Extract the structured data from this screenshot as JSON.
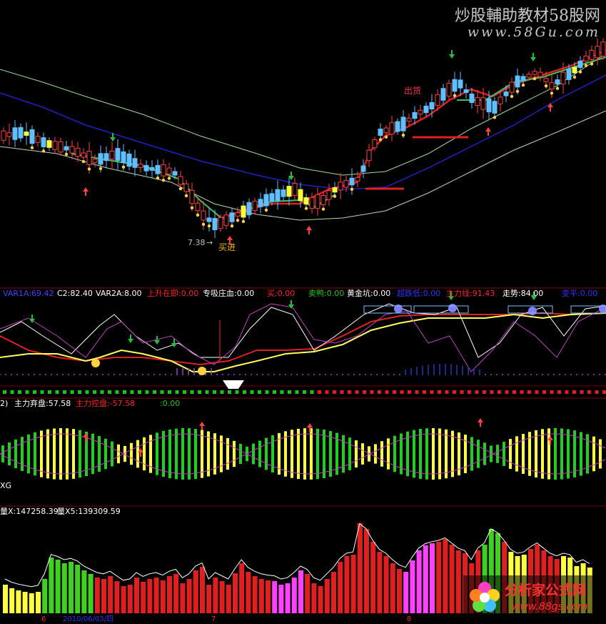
{
  "watermark": {
    "title": "炒股輔助教材58股网",
    "url": "www.58Gu.com"
  },
  "logo": {
    "name": "分析家公式网",
    "url": "www.88gs.com"
  },
  "panel1": {
    "price_labels": [
      "7.38",
      "买进",
      "出货"
    ],
    "arrow_text": "→"
  },
  "panel2": {
    "indicators": [
      {
        "text": "VAR1A:69.42",
        "color": "#4040ff"
      },
      {
        "text": "C2:82.40",
        "color": "#ffffff"
      },
      {
        "text": "VAR2A:8.00",
        "color": "#ffffff"
      },
      {
        "text": "上升在即:0.00",
        "color": "#ff2020"
      },
      {
        "text": "专吸庄血:0.00",
        "color": "#ffffff"
      },
      {
        "text": "买:0.00",
        "color": "#ff2020"
      },
      {
        "text": "卖鸭:0.00",
        "color": "#20c020"
      },
      {
        "text": "黄金坑:0.00",
        "color": "#ffffff"
      },
      {
        "text": "超跌低:0.00",
        "color": "#3030ff"
      },
      {
        "text": "主力线:91.43",
        "color": "#ff2020"
      },
      {
        "text": "走势:84.00",
        "color": "#ffffff"
      },
      {
        "text": "变平:0.00",
        "color": "#3030ff"
      }
    ],
    "buy_label": "买",
    "sell_label": "卖"
  },
  "panel3": {
    "indicators": [
      {
        "text": "2)",
        "color": "#ffffff"
      },
      {
        "text": "主力弃盘:57.58",
        "color": "#ffffff"
      },
      {
        "text": "主力控盘:-57.58",
        "color": "#ff2020"
      },
      {
        "text": ":0.00",
        "color": "#20c020"
      }
    ]
  },
  "panel4": {
    "title": "XG",
    "indicators": [
      {
        "text": "量X:147258.39",
        "color": "#ffffff"
      },
      {
        "text": "量X5:139309.59",
        "color": "#ffffff"
      }
    ],
    "date_label": "2010/06/03/四",
    "axis_marks": [
      "6",
      "7",
      "8"
    ]
  },
  "chart_data": [
    {
      "type": "candlestick",
      "title": "",
      "y_unit": "price",
      "annotations": [
        "7.38",
        "买进",
        "出货"
      ],
      "series": [
        {
          "name": "",
          "color": "#ff2020"
        },
        {
          "name": "",
          "color": "#20c040"
        },
        {
          "name": "",
          "color": "#3030ff"
        },
        {
          "name": "",
          "color": "#c0e0a0"
        }
      ]
    },
    {
      "type": "line",
      "title": "",
      "series_labels": [
        "VAR1A",
        "C2",
        "VAR2A",
        "上升在即",
        "专吸庄血",
        "买",
        "卖鸭",
        "黄金坑",
        "超跌低",
        "主力线",
        "走势",
        "变平"
      ],
      "latest_values": [
        69.42,
        82.4,
        8.0,
        0.0,
        0.0,
        0.0,
        0.0,
        0.0,
        0.0,
        91.43,
        84.0,
        0.0
      ]
    },
    {
      "type": "bar",
      "title": "",
      "series_labels": [
        "主力弃盘",
        "主力控盘"
      ],
      "latest_values": [
        57.58,
        -57.58
      ]
    },
    {
      "type": "bar",
      "title": "",
      "series_labels": [
        "量X",
        "量X5"
      ],
      "latest_values": [
        147258.39,
        139309.59
      ]
    }
  ]
}
